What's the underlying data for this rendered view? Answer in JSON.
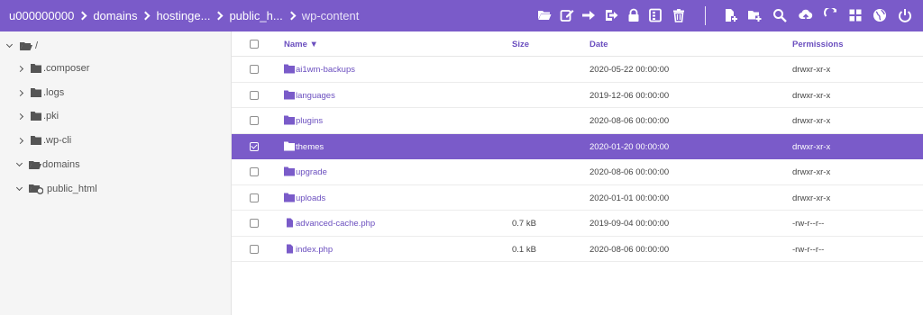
{
  "breadcrumb": [
    "u000000000",
    "domains",
    "hostinge...",
    "public_h...",
    "wp-content"
  ],
  "toolbar": {
    "icons": [
      "folder-open-icon",
      "edit-icon",
      "move-icon",
      "logout-icon",
      "lock-icon",
      "archive-icon",
      "trash-icon",
      "new-file-icon",
      "new-folder-icon",
      "search-icon",
      "upload-icon",
      "refresh-icon",
      "grid-icon",
      "globe-icon",
      "power-icon"
    ]
  },
  "tree": [
    {
      "label": "/",
      "expanded": true
    },
    {
      "label": ".composer",
      "expanded": false
    },
    {
      "label": ".logs",
      "expanded": false
    },
    {
      "label": ".pki",
      "expanded": false
    },
    {
      "label": ".wp-cli",
      "expanded": false
    },
    {
      "label": "domains",
      "expanded": true
    },
    {
      "label": "public_html",
      "expanded": true
    }
  ],
  "table": {
    "columns": {
      "name": "Name ▼",
      "size": "Size",
      "date": "Date",
      "permissions": "Permissions"
    },
    "rows": [
      {
        "type": "folder",
        "name": "ai1wm-backups",
        "size": "",
        "date": "2020-05-22 00:00:00",
        "perm": "drwxr-xr-x",
        "selected": false
      },
      {
        "type": "folder",
        "name": "languages",
        "size": "",
        "date": "2019-12-06 00:00:00",
        "perm": "drwxr-xr-x",
        "selected": false
      },
      {
        "type": "folder",
        "name": "plugins",
        "size": "",
        "date": "2020-08-06 00:00:00",
        "perm": "drwxr-xr-x",
        "selected": false
      },
      {
        "type": "folder",
        "name": "themes",
        "size": "",
        "date": "2020-01-20 00:00:00",
        "perm": "drwxr-xr-x",
        "selected": true
      },
      {
        "type": "folder",
        "name": "upgrade",
        "size": "",
        "date": "2020-08-06 00:00:00",
        "perm": "drwxr-xr-x",
        "selected": false
      },
      {
        "type": "folder",
        "name": "uploads",
        "size": "",
        "date": "2020-01-01 00:00:00",
        "perm": "drwxr-xr-x",
        "selected": false
      },
      {
        "type": "file",
        "name": "advanced-cache.php",
        "size": "0.7 kB",
        "date": "2019-09-04 00:00:00",
        "perm": "-rw-r--r--",
        "selected": false
      },
      {
        "type": "file",
        "name": "index.php",
        "size": "0.1 kB",
        "date": "2020-08-06 00:00:00",
        "perm": "-rw-r--r--",
        "selected": false
      }
    ]
  },
  "colors": {
    "accent": "#7a5bc9",
    "link": "#6b4fbf"
  }
}
